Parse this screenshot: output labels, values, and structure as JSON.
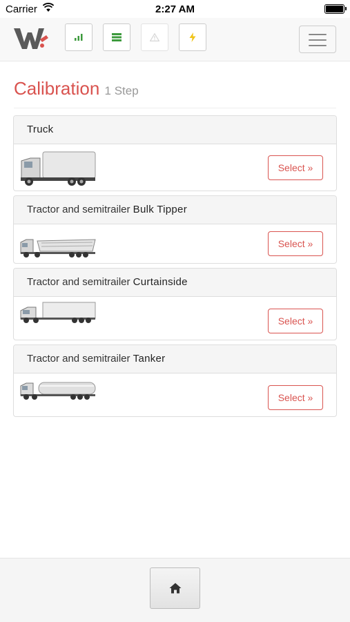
{
  "status_bar": {
    "carrier": "Carrier",
    "time": "2:27 AM"
  },
  "navbar": {
    "icons": [
      "signal-icon",
      "list-icon",
      "warning-icon",
      "lightning-icon"
    ],
    "accent_green": "#3c9a3c",
    "accent_yellow": "#f0c419"
  },
  "page": {
    "title": "Calibration",
    "subtitle": "1 Step"
  },
  "vehicles": [
    {
      "prefix": "",
      "name": "Truck",
      "button": "Select »"
    },
    {
      "prefix": "Tractor and semitrailer ",
      "name": "Bulk Tipper",
      "button": "Select »"
    },
    {
      "prefix": "Tractor and semitrailer ",
      "name": "Curtainside",
      "button": "Select »"
    },
    {
      "prefix": "Tractor and semitrailer ",
      "name": "Tanker",
      "button": "Select »"
    }
  ],
  "colors": {
    "accent": "#d9534f"
  }
}
